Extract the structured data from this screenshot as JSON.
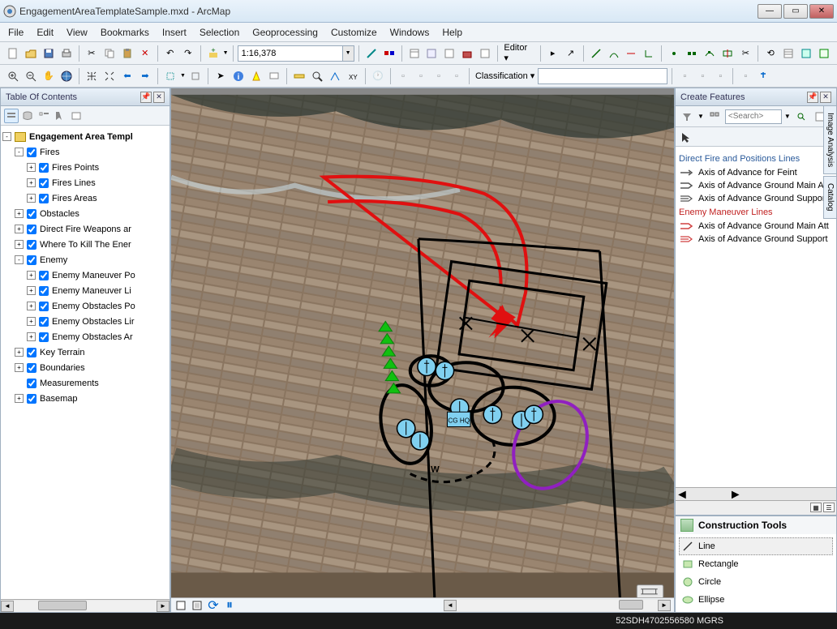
{
  "window": {
    "title": "EngagementAreaTemplateSample.mxd - ArcMap"
  },
  "menu": [
    "File",
    "Edit",
    "View",
    "Bookmarks",
    "Insert",
    "Selection",
    "Geoprocessing",
    "Customize",
    "Windows",
    "Help"
  ],
  "toolbar": {
    "scale": "1:16,378",
    "editor_label": "Editor",
    "classification_label": "Classification"
  },
  "toc": {
    "title": "Table Of Contents",
    "root": "Engagement Area Templ",
    "nodes": [
      {
        "label": "Fires",
        "level": 1,
        "checked": true,
        "exp": "-"
      },
      {
        "label": "Fires Points",
        "level": 2,
        "checked": true,
        "exp": "+"
      },
      {
        "label": "Fires Lines",
        "level": 2,
        "checked": true,
        "exp": "+"
      },
      {
        "label": "Fires Areas",
        "level": 2,
        "checked": true,
        "exp": "+"
      },
      {
        "label": "Obstacles",
        "level": 1,
        "checked": true,
        "exp": "+"
      },
      {
        "label": "Direct Fire Weapons ar",
        "level": 1,
        "checked": true,
        "exp": "+"
      },
      {
        "label": "Where To Kill The Ener",
        "level": 1,
        "checked": true,
        "exp": "+"
      },
      {
        "label": "Enemy",
        "level": 1,
        "checked": true,
        "exp": "-"
      },
      {
        "label": "Enemy Maneuver Po",
        "level": 2,
        "checked": true,
        "exp": "+"
      },
      {
        "label": "Enemy Maneuver Li",
        "level": 2,
        "checked": true,
        "exp": "+"
      },
      {
        "label": "Enemy Obstacles Po",
        "level": 2,
        "checked": true,
        "exp": "+"
      },
      {
        "label": "Enemy Obstacles Lir",
        "level": 2,
        "checked": true,
        "exp": "+"
      },
      {
        "label": "Enemy Obstacles Ar",
        "level": 2,
        "checked": true,
        "exp": "+"
      },
      {
        "label": "Key Terrain",
        "level": 1,
        "checked": true,
        "exp": "+"
      },
      {
        "label": "Boundaries",
        "level": 1,
        "checked": true,
        "exp": "+"
      },
      {
        "label": "Measurements",
        "level": 1,
        "checked": true,
        "exp": null
      },
      {
        "label": "Basemap",
        "level": 1,
        "checked": true,
        "exp": "+"
      }
    ]
  },
  "cf": {
    "title": "Create Features",
    "search_placeholder": "<Search>",
    "group1": "Direct Fire and Positions Lines",
    "group1_items": [
      "Axis of Advance for Feint",
      "Axis of Advance Ground Main Att",
      "Axis of Advance Ground Support"
    ],
    "group2": "Enemy Maneuver Lines",
    "group2_items": [
      "Axis of Advance Ground Main Att",
      "Axis of Advance Ground Support"
    ]
  },
  "ct": {
    "title": "Construction Tools",
    "items": [
      "Line",
      "Rectangle",
      "Circle",
      "Ellipse"
    ]
  },
  "side_tabs": [
    "Image Analysis",
    "Catalog"
  ],
  "status": {
    "coords": "52SDH4702556580 MGRS"
  },
  "map_label_w": "W",
  "map_label_hq": "CG HQ"
}
